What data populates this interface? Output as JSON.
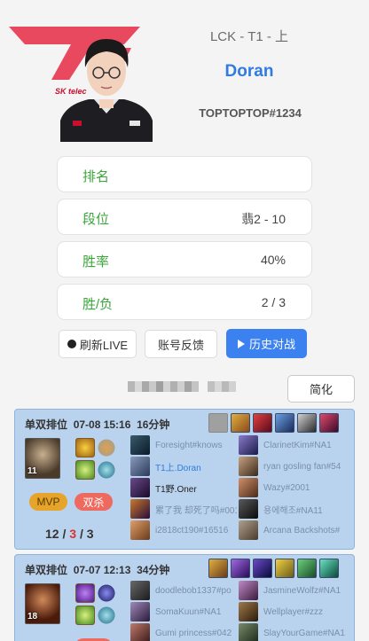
{
  "profile": {
    "team_line": "LCK - T1 - 上",
    "name": "Doran",
    "tag": "TOPTOPTOP#1234",
    "sponsor_text": "SK telec"
  },
  "info_rows": [
    {
      "label": "排名",
      "value": ""
    },
    {
      "label": "段位",
      "value": "翡2 - 10"
    },
    {
      "label": "胜率",
      "value": "40%"
    },
    {
      "label": "胜/负",
      "value": "2 / 3"
    }
  ],
  "actions": {
    "refresh_label": "刷新LIVE",
    "feedback_label": "账号反馈",
    "history_label": "历史对战",
    "simplify_label": "简化"
  },
  "matches": [
    {
      "queue": "单双排位",
      "date": "07-08 15:16",
      "duration": "16分钟",
      "level": "11",
      "badges": {
        "mvp": "MVP",
        "multi": "双杀"
      },
      "kda": {
        "k": "12",
        "d": "3",
        "a": "3",
        "sep": "/"
      },
      "items": [
        "#a0a0a0",
        "#c98a1e",
        "#b0232a",
        "#3a6fb8",
        "#3b3b3b",
        "#8a1c3c"
      ],
      "champ_color": "#6a5840",
      "spells": [
        "#d4a21a",
        "#7ac04a"
      ],
      "runes": [
        "#c8903a",
        "#6ab0c8"
      ],
      "ally": [
        {
          "name": "Foresight#knows",
          "icon": "#2a3a4a",
          "style": ""
        },
        {
          "name": "T1上.Doran",
          "icon": "#5b6b8a",
          "style": "self"
        },
        {
          "name": "T1野.Oner",
          "icon": "#3a2a4a",
          "style": "dark"
        },
        {
          "name": "累了我 却死了吗#001",
          "icon": "#4a3a2a",
          "style": ""
        },
        {
          "name": "i2818ct190#16516",
          "icon": "#8a5a3a",
          "style": ""
        }
      ],
      "enemy": [
        {
          "name": "ClarinetKim#NA1",
          "icon": "#3a3a6a",
          "style": ""
        },
        {
          "name": "ryan gosling fan#54",
          "icon": "#5a4a3a",
          "style": ""
        },
        {
          "name": "Wazy#2001",
          "icon": "#6a4a3a",
          "style": ""
        },
        {
          "name": "용에해조#NA11",
          "icon": "#2a2a2a",
          "style": ""
        },
        {
          "name": "Arcana Backshots#",
          "icon": "#6a5a4a",
          "style": ""
        }
      ]
    },
    {
      "queue": "单双排位",
      "date": "07-07 12:13",
      "duration": "34分钟",
      "level": "18",
      "badges": {
        "mvp": "",
        "multi": ""
      },
      "kda": {
        "k": "",
        "d": "",
        "a": "",
        "sep": ""
      },
      "items": [
        "#c98a1e",
        "#7a3ab8",
        "#3a2a6a",
        "#c8a01a",
        "#3a8a4a",
        "#2a8a6a"
      ],
      "champ_color": "#7a3a2a",
      "spells": [
        "#8a4ac8",
        "#7ac04a"
      ],
      "runes": [
        "#5a5ac8",
        "#6ab0c8"
      ],
      "ally": [
        {
          "name": "doodlebob1337#po",
          "icon": "#3a3a3a",
          "style": ""
        },
        {
          "name": "SomaKuun#NA1",
          "icon": "#4a3a5a",
          "style": ""
        },
        {
          "name": "Gumi princess#042",
          "icon": "#5a3a3a",
          "style": ""
        }
      ],
      "enemy": [
        {
          "name": "JasmineWolfz#NA1",
          "icon": "#6a4a6a",
          "style": ""
        },
        {
          "name": "Wellplayer#zzz",
          "icon": "#4a3a2a",
          "style": ""
        },
        {
          "name": "SlayYourGame#NA1",
          "icon": "#3a4a3a",
          "style": ""
        }
      ]
    }
  ],
  "colors": {
    "accent": "#3b82f0",
    "win_card": "#b9d3ef",
    "label_green": "#3aa63a"
  }
}
